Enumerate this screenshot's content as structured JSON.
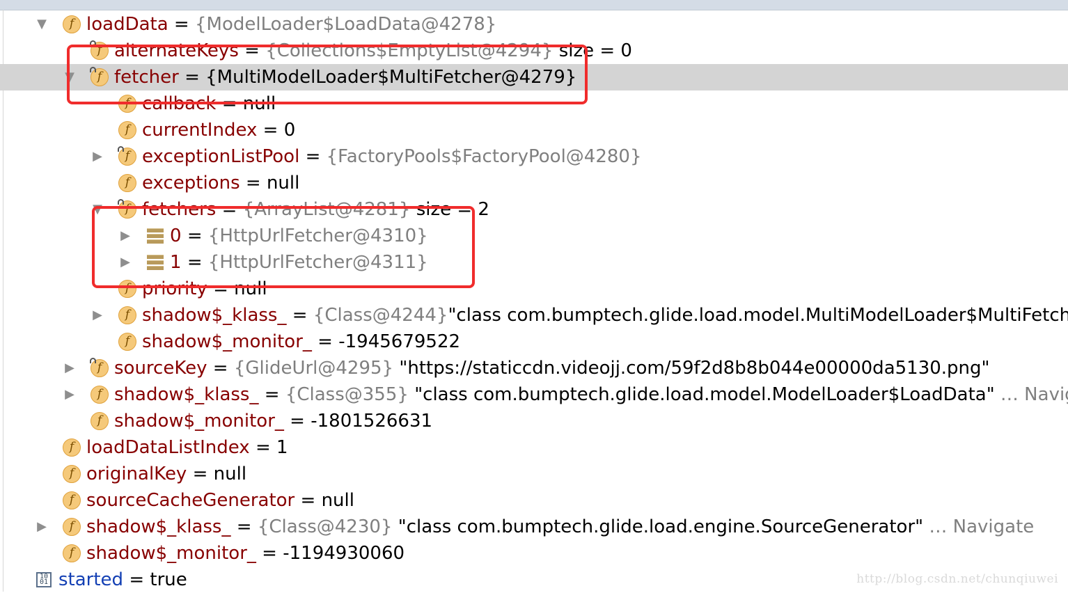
{
  "rows": [
    {
      "name": "loadData",
      "eq": "=",
      "ref": "{ModelLoader$LoadData@4278}"
    },
    {
      "name": "alternateKeys",
      "eq": "=",
      "ref": "{Collections$EmptyList@4294}",
      "val": "size = 0"
    },
    {
      "name": "fetcher",
      "eq": "=",
      "val": "{MultiModelLoader$MultiFetcher@4279}"
    },
    {
      "name": "callback",
      "eq": "=",
      "val": "null"
    },
    {
      "name": "currentIndex",
      "eq": "=",
      "val": "0"
    },
    {
      "name": "exceptionListPool",
      "eq": "=",
      "ref": "{FactoryPools$FactoryPool@4280}"
    },
    {
      "name": "exceptions",
      "eq": "=",
      "val": "null"
    },
    {
      "name": "fetchers",
      "eq": "=",
      "ref": "{ArrayList@4281}",
      "val": "size = 2"
    },
    {
      "name": "0",
      "eq": "=",
      "ref": "{HttpUrlFetcher@4310}"
    },
    {
      "name": "1",
      "eq": "=",
      "ref": "{HttpUrlFetcher@4311}"
    },
    {
      "name": "priority",
      "eq": "=",
      "val": "null"
    },
    {
      "name": "shadow$_klass_",
      "eq": "=",
      "ref": "{Class@4244}",
      "val": "\"class com.bumptech.glide.load.model.MultiModelLoader$MultiFetcher\""
    },
    {
      "name": "shadow$_monitor_",
      "eq": "=",
      "val": "-1945679522"
    },
    {
      "name": "sourceKey",
      "eq": "=",
      "ref": "{GlideUrl@4295}",
      "val": "\"https://staticcdn.videojj.com/59f2d8b8b044e00000da5130.png\""
    },
    {
      "name": "shadow$_klass_",
      "eq": "=",
      "ref": "{Class@355}",
      "val": "\"class com.bumptech.glide.load.model.ModelLoader$LoadData\"",
      "nav": "… Navigate"
    },
    {
      "name": "shadow$_monitor_",
      "eq": "=",
      "val": "-1801526631"
    },
    {
      "name": "loadDataListIndex",
      "eq": "=",
      "val": "1"
    },
    {
      "name": "originalKey",
      "eq": "=",
      "val": "null"
    },
    {
      "name": "sourceCacheGenerator",
      "eq": "=",
      "val": "null"
    },
    {
      "name": "shadow$_klass_",
      "eq": "=",
      "ref": "{Class@4230}",
      "val": "\"class com.bumptech.glide.load.engine.SourceGenerator\"",
      "nav": "… Navigate"
    },
    {
      "name": "shadow$_monitor_",
      "eq": "=",
      "val": "-1194930060"
    },
    {
      "name": "started",
      "eq": "=",
      "val": "true"
    }
  ],
  "icons": {
    "field": "f",
    "boolean": "10\n01"
  },
  "watermark": "http://blog.csdn.net/chunqiuwei",
  "_annotations": [
    {
      "color": "#f02c2c"
    },
    {
      "color": "#f02c2c"
    }
  ]
}
